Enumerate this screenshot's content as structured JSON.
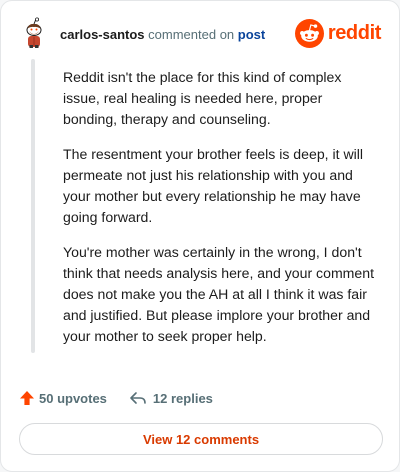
{
  "header": {
    "username": "carlos-santos",
    "action_text": "commented on",
    "post_link": "post",
    "brand_name": "reddit",
    "avatar_icon": "snoo-avatar-icon",
    "brand_icon": "reddit-snoo-icon"
  },
  "comment": {
    "paragraphs": [
      "Reddit isn't the place for this kind of complex issue, real healing is needed here, proper bonding, therapy and counseling.",
      "The resentment your brother feels is deep, it will permeate not just his relationship with you and your mother but every relationship he may have going forward.",
      "You're mother was certainly in the wrong, I don't think that needs analysis here, and your comment does not make you the AH at all I think it was fair and justified. But please implore your brother and your mother to seek proper help."
    ]
  },
  "actions": {
    "upvotes_label": "50 upvotes",
    "replies_label": "12 replies",
    "upvote_icon": "upvote-arrow-icon",
    "reply_icon": "reply-arrow-icon"
  },
  "footer": {
    "view_button_label": "View 12 comments"
  },
  "colors": {
    "brand": "#ff4500",
    "link": "#0a449b",
    "button_text": "#d93a00",
    "muted": "#576f76",
    "thread_line": "#e2e4e6"
  }
}
